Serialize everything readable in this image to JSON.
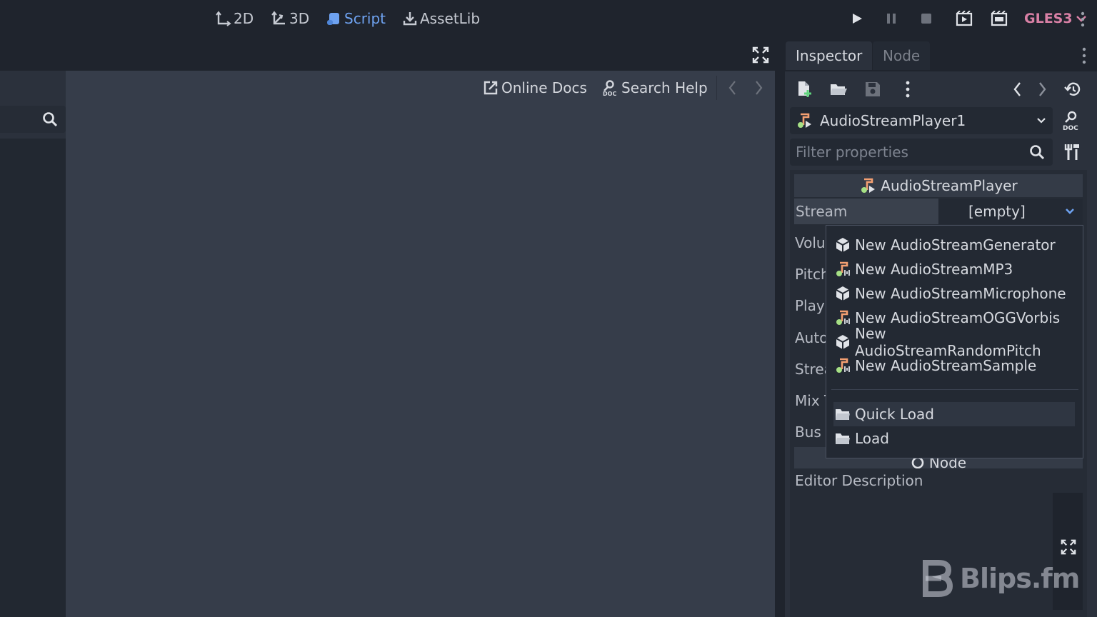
{
  "top_bar": {
    "workspaces": [
      {
        "label": "2D",
        "icon": "2d-icon",
        "active": false
      },
      {
        "label": "3D",
        "icon": "3d-icon",
        "active": false
      },
      {
        "label": "Script",
        "icon": "script-icon",
        "active": true
      },
      {
        "label": "AssetLib",
        "icon": "assetlib-icon",
        "active": false
      }
    ],
    "run_controls": [
      "play-icon",
      "pause-icon",
      "stop-icon",
      "play-scene-icon",
      "play-custom-scene-icon"
    ],
    "renderer": "GLES3"
  },
  "script_toolbar": {
    "online_docs": "Online Docs",
    "search_help": "Search Help"
  },
  "inspector": {
    "tabs": [
      "Inspector",
      "Node"
    ],
    "node_name": "AudioStreamPlayer1",
    "filter_placeholder": "Filter properties",
    "section_title": "AudioStreamPlayer",
    "stream_label": "Stream",
    "stream_value": "[empty]",
    "property_labels": [
      "Volu",
      "Pitch",
      "Play",
      "Auto",
      "Strea",
      "Mix T",
      "Bus"
    ],
    "node_section": "Node",
    "editor_description": "Editor Description"
  },
  "popup_menu": {
    "items": [
      {
        "label": "New AudioStreamGenerator",
        "icon": "cube-icon"
      },
      {
        "label": "New AudioStreamMP3",
        "icon": "audio-stream-icon"
      },
      {
        "label": "New AudioStreamMicrophone",
        "icon": "cube-icon"
      },
      {
        "label": "New AudioStreamOGGVorbis",
        "icon": "audio-stream-icon"
      },
      {
        "label": "New AudioStreamRandomPitch",
        "icon": "cube-icon"
      },
      {
        "label": "New AudioStreamSample",
        "icon": "audio-stream-icon"
      }
    ],
    "load_items": [
      {
        "label": "Quick Load",
        "icon": "folder-icon"
      },
      {
        "label": "Load",
        "icon": "folder-icon"
      }
    ]
  },
  "watermark": "Blips.fm",
  "colors": {
    "accent": "#6ea2f0",
    "renderer": "#d880a5",
    "background": "#363d4a",
    "panel": "#2b313c",
    "bar": "#1f242d"
  }
}
